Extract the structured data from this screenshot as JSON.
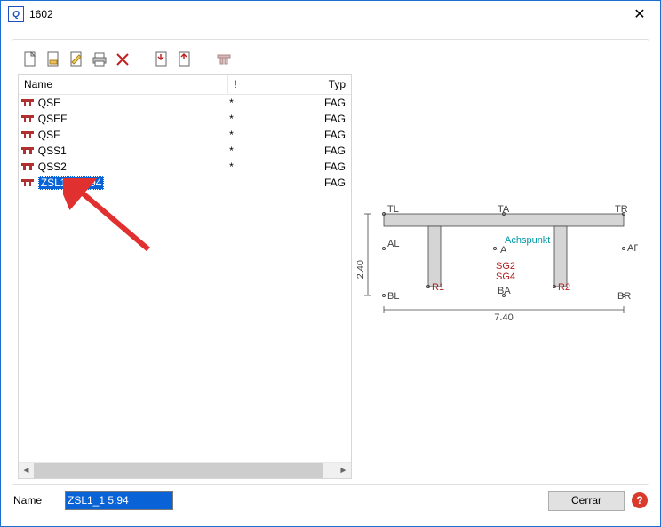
{
  "window": {
    "title": "1602"
  },
  "list": {
    "headers": {
      "name": "Name",
      "mark": "!",
      "typ": "Typ"
    },
    "items": [
      {
        "icon": "tt-red",
        "name": "QSE",
        "mark": "*",
        "typ": "FAG",
        "selected": false
      },
      {
        "icon": "tt-red",
        "name": "QSEF",
        "mark": "*",
        "typ": "FAG",
        "selected": false
      },
      {
        "icon": "tt-red",
        "name": "QSF",
        "mark": "*",
        "typ": "FAG",
        "selected": false
      },
      {
        "icon": "tt-wide",
        "name": "QSS1",
        "mark": "*",
        "typ": "FAG",
        "selected": false
      },
      {
        "icon": "tt-wide",
        "name": "QSS2",
        "mark": "*",
        "typ": "FAG",
        "selected": false
      },
      {
        "icon": "tt-red",
        "name": "ZSL1_1 5.94",
        "mark": "",
        "typ": "FAG",
        "selected": true
      }
    ]
  },
  "preview": {
    "labels": {
      "TL": "TL",
      "TA": "TA",
      "TR": "TR",
      "AL": "AL",
      "A": "A",
      "Achspunkt": "Achspunkt",
      "AR": "AR",
      "SG2": "SG2",
      "SG4": "SG4",
      "R1": "R1",
      "R2": "R2",
      "BL": "BL",
      "BA": "BA",
      "BR": "BR"
    },
    "dims": {
      "h": "2.40",
      "w": "7.40"
    }
  },
  "footer": {
    "nameLabel": "Name",
    "nameValue": "ZSL1_1 5.94",
    "closeLabel": "Cerrar",
    "help": "?"
  }
}
